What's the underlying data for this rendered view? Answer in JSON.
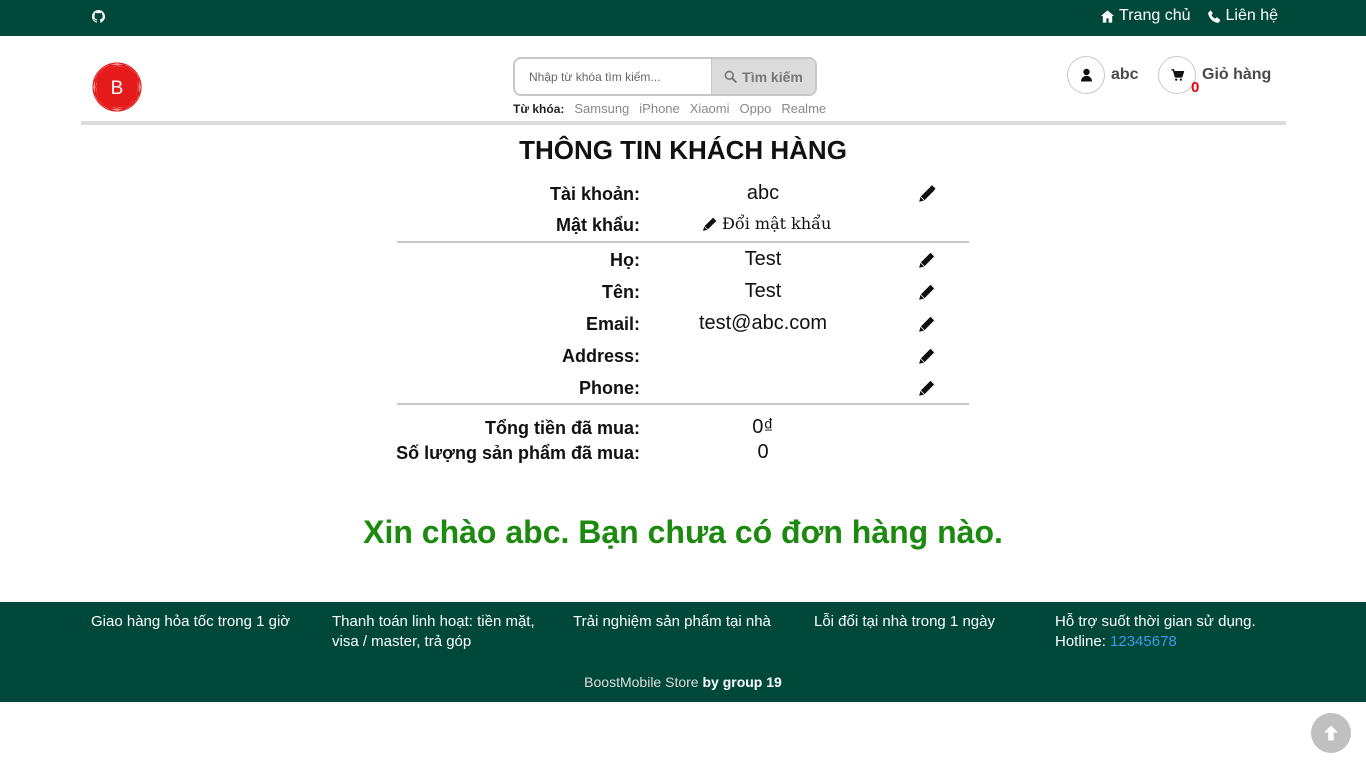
{
  "topbar": {
    "home_label": "Trang chủ",
    "contact_label": "Liên hệ"
  },
  "header": {
    "logo_letter": "B",
    "search": {
      "placeholder": "Nhập từ khóa tìm kiếm...",
      "button_label": "Tìm kiếm"
    },
    "keywords_label": "Từ khóa:",
    "keywords": [
      "Samsung",
      "iPhone",
      "Xiaomi",
      "Oppo",
      "Realme"
    ],
    "account_name": "abc",
    "cart_label": "Giỏ hàng",
    "cart_count": "0"
  },
  "profile": {
    "title": "THÔNG TIN KHÁCH HÀNG",
    "account": {
      "label": "Tài khoản:",
      "value": "abc"
    },
    "password": {
      "label": "Mật khẩu:",
      "link": "Đổi mật khẩu"
    },
    "last_name": {
      "label": "Họ:",
      "value": "Test"
    },
    "first_name": {
      "label": "Tên:",
      "value": "Test"
    },
    "email": {
      "label": "Email:",
      "value": "test@abc.com"
    },
    "address": {
      "label": "Address:",
      "value": ""
    },
    "phone": {
      "label": "Phone:",
      "value": ""
    },
    "total_spent": {
      "label": "Tổng tiền đã mua:",
      "value": "0₫"
    },
    "items_bought": {
      "label": "Số lượng sản phẩm đã mua:",
      "value": "0"
    }
  },
  "message": "Xin chào abc. Bạn chưa có đơn hàng nào.",
  "footer": {
    "features": [
      "Giao hàng hỏa tốc trong 1 giờ",
      "Thanh toán linh hoạt: tiền mặt, visa / master, trả góp",
      "Trải nghiệm sản phẩm tại nhà",
      "Lỗi đổi tại nhà trong 1 ngày"
    ],
    "support_text": "Hỗ trợ suốt thời gian sử dụng.",
    "hotline_label": "Hotline:",
    "hotline_number": "12345678",
    "brand": "BoostMobile Store",
    "by": "by group 19"
  },
  "colors": {
    "brand_green": "#00483a",
    "message_green": "#1b8a0f",
    "logo_red": "#e51b1b",
    "cart_count_red": "#e00000",
    "hotline_blue": "#3d9be9"
  },
  "icons": [
    "github-icon",
    "home-icon",
    "phone-icon",
    "search-icon",
    "user-icon",
    "cart-icon",
    "pencil-icon",
    "arrow-up-icon"
  ]
}
